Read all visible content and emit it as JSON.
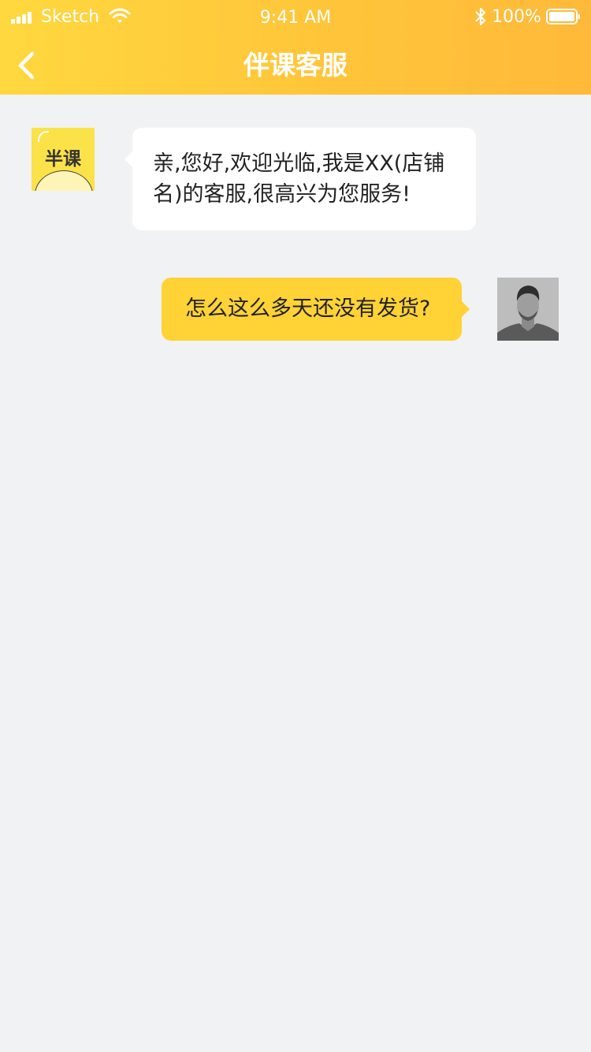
{
  "status_bar": {
    "carrier": "Sketch",
    "time": "9:41 AM",
    "battery": "100%"
  },
  "nav": {
    "title": "伴课客服",
    "back_icon": "chevron-left-icon"
  },
  "colors": {
    "header_start": "#ffd83f",
    "header_end": "#ffb93a",
    "outgoing_bubble": "#ffd236",
    "incoming_bubble": "#ffffff",
    "background": "#f1f2f4"
  },
  "messages": [
    {
      "sender": "service",
      "avatar_text": "半课",
      "text": "亲,您好,欢迎光临,我是XX(店铺名)的客服,很高兴为您服务!"
    },
    {
      "sender": "user",
      "text": "怎么这么多天还没有发货?"
    }
  ]
}
